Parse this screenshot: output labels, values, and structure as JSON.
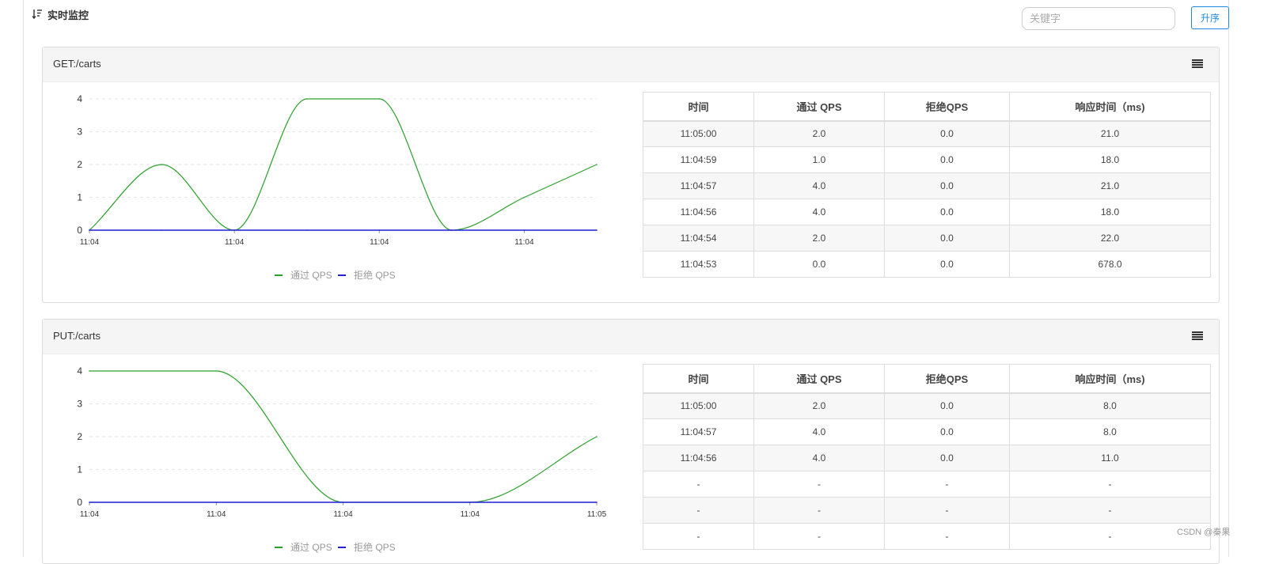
{
  "header": {
    "title": "实时监控",
    "sort_icon": "sort-descending-icon",
    "search_placeholder": "关键字",
    "sort_button": "升序"
  },
  "panels": [
    {
      "title": "GET:/carts",
      "menu_icon": "hamburger-menu-icon",
      "table": {
        "headers": [
          "时间",
          "通过 QPS",
          "拒绝QPS",
          "响应时间（ms)"
        ],
        "rows": [
          [
            "11:05:00",
            "2.0",
            "0.0",
            "21.0"
          ],
          [
            "11:04:59",
            "1.0",
            "0.0",
            "18.0"
          ],
          [
            "11:04:57",
            "4.0",
            "0.0",
            "21.0"
          ],
          [
            "11:04:56",
            "4.0",
            "0.0",
            "18.0"
          ],
          [
            "11:04:54",
            "2.0",
            "0.0",
            "22.0"
          ],
          [
            "11:04:53",
            "0.0",
            "0.0",
            "678.0"
          ]
        ]
      }
    },
    {
      "title": "PUT:/carts",
      "menu_icon": "hamburger-menu-icon",
      "table": {
        "headers": [
          "时间",
          "通过 QPS",
          "拒绝QPS",
          "响应时间（ms)"
        ],
        "rows": [
          [
            "11:05:00",
            "2.0",
            "0.0",
            "8.0"
          ],
          [
            "11:04:57",
            "4.0",
            "0.0",
            "8.0"
          ],
          [
            "11:04:56",
            "4.0",
            "0.0",
            "11.0"
          ],
          [
            "-",
            "-",
            "-",
            "-"
          ],
          [
            "-",
            "-",
            "-",
            "-"
          ],
          [
            "-",
            "-",
            "-",
            "-"
          ]
        ]
      }
    }
  ],
  "chart_data": [
    {
      "type": "line",
      "ylim": [
        0,
        4
      ],
      "y_ticks": [
        0,
        1,
        2,
        3,
        4
      ],
      "x_tick_labels": [
        "11:04",
        "11:04",
        "11:04",
        "11:04"
      ],
      "x": [
        "11:04:53",
        "11:04:54",
        "11:04:55",
        "11:04:56",
        "11:04:57",
        "11:04:58",
        "11:04:59",
        "11:05:00"
      ],
      "series": [
        {
          "name": "通过 QPS",
          "color": "#2ca02c",
          "values": [
            0,
            2,
            0,
            4,
            4,
            0,
            1,
            2
          ]
        },
        {
          "name": "拒绝 QPS",
          "color": "#1f1fdc",
          "values": [
            0,
            0,
            0,
            0,
            0,
            0,
            0,
            0
          ]
        }
      ],
      "grid": true,
      "legend": "bottom-center"
    },
    {
      "type": "line",
      "ylim": [
        0,
        4
      ],
      "y_ticks": [
        0,
        1,
        2,
        3,
        4
      ],
      "x_tick_labels": [
        "11:04",
        "11:04",
        "11:04",
        "11:04",
        "11:05"
      ],
      "x": [
        "11:04:56",
        "11:04:57",
        "11:04:58",
        "11:04:59",
        "11:05:00"
      ],
      "series": [
        {
          "name": "通过 QPS",
          "color": "#2ca02c",
          "values": [
            4,
            4,
            0,
            0,
            2
          ]
        },
        {
          "name": "拒绝 QPS",
          "color": "#1f1fdc",
          "values": [
            0,
            0,
            0,
            0,
            0
          ]
        }
      ],
      "grid": true,
      "legend": "bottom-center"
    }
  ],
  "footer": {
    "watermark": "CSDN @秦果"
  }
}
